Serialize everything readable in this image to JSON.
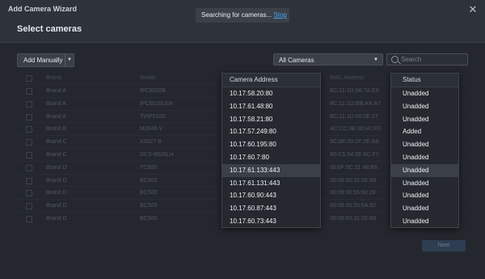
{
  "window": {
    "title": "Add Camera Wizard",
    "subtitle": "Select cameras"
  },
  "notice": {
    "text": "Searching for cameras...",
    "stop_label": "Stop"
  },
  "toolbar": {
    "add_manually_label": "Add Manually",
    "filter_value": "All Cameras",
    "search_placeholder": "Search"
  },
  "table": {
    "headers": {
      "brand": "Brand",
      "model": "Model",
      "mac": "MAC Address"
    },
    "rows": [
      {
        "brand": "Brand A",
        "model": "IPC6020B",
        "mac": "BC:11:1D:56:7A:E9"
      },
      {
        "brand": "Brand A",
        "model": "IPC6020U2A",
        "mac": "BC:11:1D:BB:AA:A7"
      },
      {
        "brand": "Brand A",
        "model": "TVIP5100",
        "mac": "BC:11:1D:00:0E:27"
      },
      {
        "brand": "Brand B",
        "model": "M3045-V",
        "mac": "AC:CC:8E:3D:41:F0"
      },
      {
        "brand": "Brand C",
        "model": "X3027-8",
        "mac": "9C:8E:00:2F:2E:A9"
      },
      {
        "brand": "Brand C",
        "model": "DCS-8526LH",
        "mac": "B0:C5:54:5E:6C:F7"
      },
      {
        "brand": "Brand D",
        "model": "TC500",
        "mac": "00:0F:0C:21:48:B6"
      },
      {
        "brand": "Brand D",
        "model": "BC500",
        "mac": "00:09:00:31:2E:89"
      },
      {
        "brand": "Brand D",
        "model": "BC500",
        "mac": "00:09:00:55:60:29"
      },
      {
        "brand": "Brand D",
        "model": "BC500",
        "mac": "00:09:00:55:6A:82"
      },
      {
        "brand": "Brand D",
        "model": "BC500",
        "mac": "00:09:00:31:2E:83"
      }
    ]
  },
  "address_popup": {
    "header": "Camera Address",
    "items": [
      "10.17.58.20:80",
      "10.17.61.48:80",
      "10.17.58.21:80",
      "10.17.57.249:80",
      "10.17.60.195:80",
      "10.17.60.7:80",
      "10.17.61.133:443",
      "10.17.61.131:443",
      "10.17.60.90:443",
      "10.17.60.87:443",
      "10.17.60.73:443"
    ],
    "highlighted_index": 6
  },
  "status_popup": {
    "header": "Status",
    "items": [
      "Unadded",
      "Unadded",
      "Unadded",
      "Added",
      "Unadded",
      "Unadded",
      "Unadded",
      "Unadded",
      "Unadded",
      "Unadded",
      "Unadded"
    ],
    "highlighted_index": 6
  },
  "footer": {
    "next_label": "Next"
  }
}
